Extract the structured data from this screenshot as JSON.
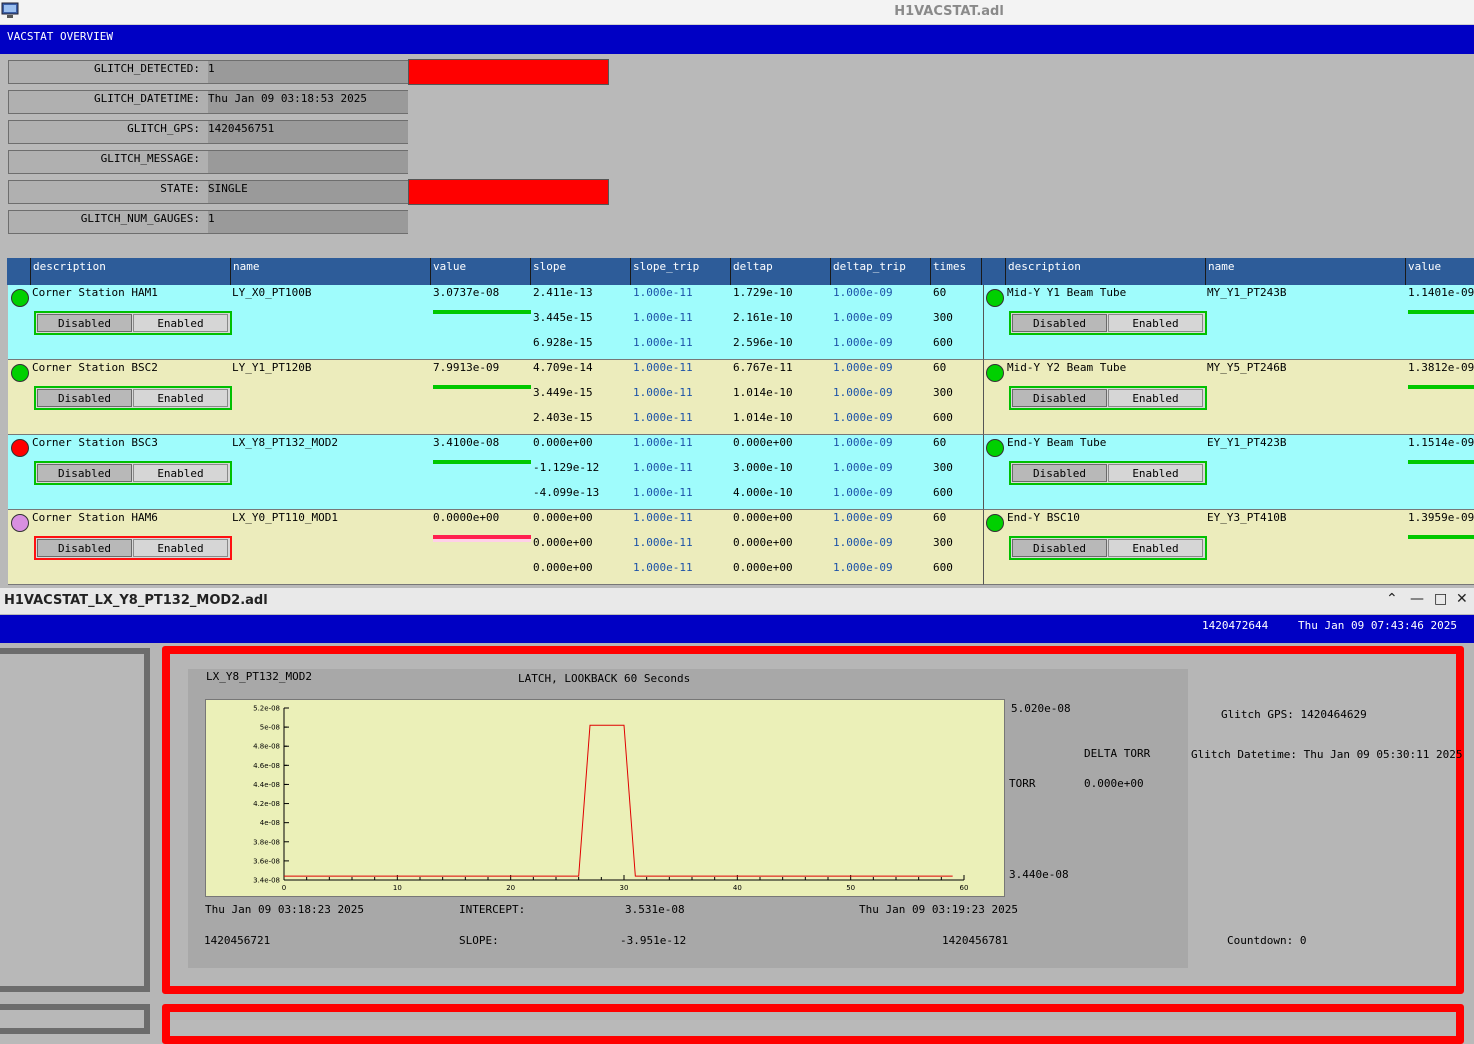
{
  "window1": {
    "title": "H1VACSTAT.adl",
    "banner": "VACSTAT OVERVIEW"
  },
  "glitch": [
    {
      "label": "GLITCH_DETECTED:",
      "value": "1",
      "alarm": true
    },
    {
      "label": "GLITCH_DATETIME:",
      "value": "Thu Jan 09 03:18:53 2025",
      "alarm": false
    },
    {
      "label": "GLITCH_GPS:",
      "value": "1420456751",
      "alarm": false
    },
    {
      "label": "GLITCH_MESSAGE:",
      "value": "",
      "alarm": false
    },
    {
      "label": "STATE:",
      "value": "SINGLE",
      "alarm": true
    },
    {
      "label": "GLITCH_NUM_GAUGES:",
      "value": "1",
      "alarm": false
    }
  ],
  "table_left": {
    "headers": [
      "description",
      "name",
      "value",
      "slope",
      "slope_trip",
      "deltap",
      "deltap_trip",
      "times"
    ],
    "rows": [
      {
        "description": "Corner Station HAM1",
        "name": "LY_X0_PT100B",
        "value": "3.0737e-08",
        "status_color": "#00d000",
        "toggle_border": "green",
        "slope": [
          "2.411e-13",
          "3.445e-15",
          "6.928e-15"
        ],
        "slope_trip": [
          "1.000e-11",
          "1.000e-11",
          "1.000e-11"
        ],
        "deltap": [
          "1.729e-10",
          "2.161e-10",
          "2.596e-10"
        ],
        "deltap_trip": [
          "1.000e-09",
          "1.000e-09",
          "1.000e-09"
        ],
        "times": [
          "60",
          "300",
          "600"
        ]
      },
      {
        "description": "Corner Station BSC2",
        "name": "LY_Y1_PT120B",
        "value": "7.9913e-09",
        "status_color": "#00d000",
        "toggle_border": "green",
        "slope": [
          "4.709e-14",
          "3.449e-15",
          "2.403e-15"
        ],
        "slope_trip": [
          "1.000e-11",
          "1.000e-11",
          "1.000e-11"
        ],
        "deltap": [
          "6.767e-11",
          "1.014e-10",
          "1.014e-10"
        ],
        "deltap_trip": [
          "1.000e-09",
          "1.000e-09",
          "1.000e-09"
        ],
        "times": [
          "60",
          "300",
          "600"
        ]
      },
      {
        "description": "Corner Station BSC3",
        "name": "LX_Y8_PT132_MOD2",
        "value": "3.4100e-08",
        "status_color": "#ff0000",
        "toggle_border": "green",
        "slope": [
          "0.000e+00",
          "-1.129e-12",
          "-4.099e-13"
        ],
        "slope_trip": [
          "1.000e-11",
          "1.000e-11",
          "1.000e-11"
        ],
        "deltap": [
          "0.000e+00",
          "3.000e-10",
          "4.000e-10"
        ],
        "deltap_trip": [
          "1.000e-09",
          "1.000e-09",
          "1.000e-09"
        ],
        "times": [
          "60",
          "300",
          "600"
        ]
      },
      {
        "description": "Corner Station HAM6",
        "name": "LX_Y0_PT110_MOD1",
        "value": "0.0000e+00",
        "status_color": "#d890e0",
        "toggle_border": "red",
        "slope": [
          "0.000e+00",
          "0.000e+00",
          "0.000e+00"
        ],
        "slope_trip": [
          "1.000e-11",
          "1.000e-11",
          "1.000e-11"
        ],
        "deltap": [
          "0.000e+00",
          "0.000e+00",
          "0.000e+00"
        ],
        "deltap_trip": [
          "1.000e-09",
          "1.000e-09",
          "1.000e-09"
        ],
        "times": [
          "60",
          "300",
          "600"
        ]
      }
    ]
  },
  "table_right": {
    "headers": [
      "description",
      "name",
      "value"
    ],
    "rows": [
      {
        "description": "Mid-Y Y1 Beam Tube",
        "name": "MY_Y1_PT243B",
        "value": "1.1401e-09"
      },
      {
        "description": "Mid-Y Y2 Beam Tube",
        "name": "MY_Y5_PT246B",
        "value": "1.3812e-09"
      },
      {
        "description": "End-Y Beam Tube",
        "name": "EY_Y1_PT423B",
        "value": "1.1514e-09"
      },
      {
        "description": "End-Y BSC10",
        "name": "EY_Y3_PT410B",
        "value": "1.3959e-09"
      }
    ]
  },
  "toggle": {
    "disabled": "Disabled",
    "enabled": "Enabled"
  },
  "window2": {
    "title": "H1VACSTAT_LX_Y8_PT132_MOD2.adl",
    "gps_now": "1420472644",
    "datetime_now": "Thu Jan 09 07:43:46 2025",
    "gauge_name": "LX_Y8_PT132_MOD2",
    "mode_label": "LATCH, LOOKBACK 60 Seconds",
    "ymax_label": "5.020e-08",
    "ymin_label": "3.440e-08",
    "unit_label": "TORR",
    "delta_label": "DELTA TORR",
    "delta_value": "0.000e+00",
    "glitch_gps": "Glitch GPS: 1420464629",
    "glitch_datetime": "Glitch Datetime: Thu Jan 09 05:30:11 2025",
    "start_datetime": "Thu Jan 09 03:18:23 2025",
    "end_datetime": "Thu Jan 09 03:19:23 2025",
    "start_gps": "1420456721",
    "end_gps": "1420456781",
    "intercept_label": "INTERCEPT:",
    "intercept_value": "3.531e-08",
    "slope_label": "SLOPE:",
    "slope_value": "-3.951e-12",
    "countdown": "Countdown: 0"
  },
  "chart_data": {
    "type": "line",
    "xlim": [
      0,
      60
    ],
    "ylim": [
      3.4e-08,
      5.2e-08
    ],
    "x_ticks": [
      "0",
      "10",
      "20",
      "30",
      "40",
      "50",
      "60"
    ],
    "y_ticks": [
      "3.4e-08",
      "3.6e-08",
      "3.8e-08",
      "4e-08",
      "4.2e-08",
      "4.4e-08",
      "4.6e-08",
      "4.8e-08",
      "5e-08",
      "5.2e-08"
    ],
    "x": [
      0,
      26,
      27,
      28,
      29,
      30,
      31,
      59
    ],
    "y": [
      3.44e-08,
      3.44e-08,
      5.02e-08,
      5.02e-08,
      5.02e-08,
      5.02e-08,
      3.44e-08,
      3.44e-08
    ],
    "line_color": "#e00000",
    "grid": false
  }
}
